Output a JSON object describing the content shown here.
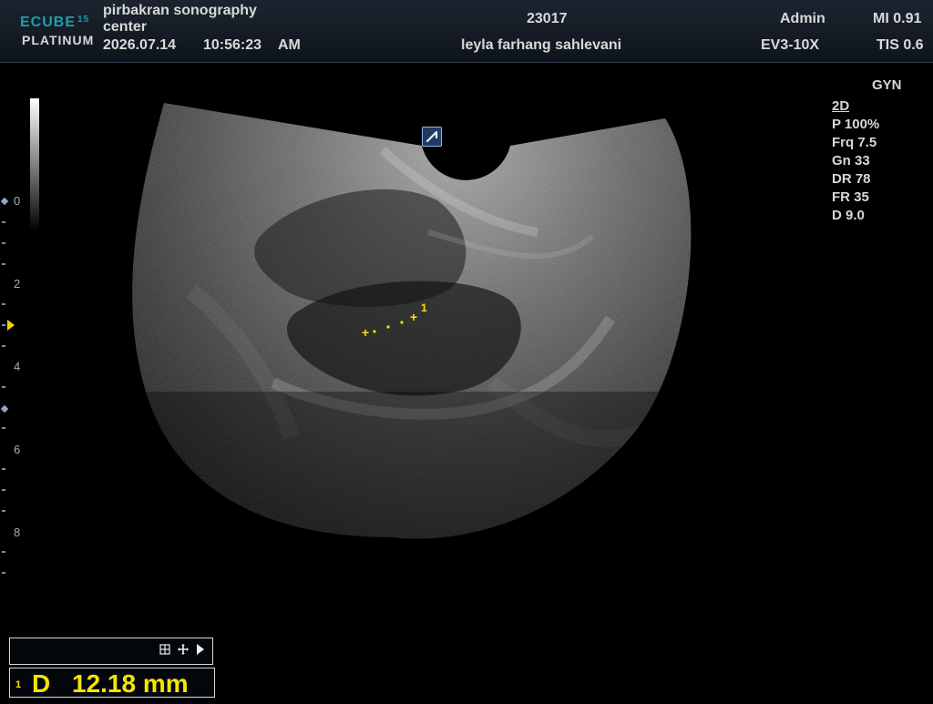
{
  "brand": {
    "line1": "ECUBE",
    "line1_number": "15",
    "line2": "PLATINUM"
  },
  "header": {
    "hospital": "pirbakran sonography\ncenter",
    "date": "2026.07.14",
    "time": "10:56:23",
    "ampm": "AM",
    "patient_id": "23017",
    "patient_name": "leyla farhang sahlevani",
    "user": "Admin",
    "probe": "EV3-10X",
    "mi": "MI 0.91",
    "tis": "TIS 0.6"
  },
  "params": {
    "preset": "GYN",
    "mode": "2D",
    "rows": [
      "P 100%",
      "Frq 7.5",
      "Gn 33",
      "DR 78",
      "FR 35",
      "D 9.0"
    ]
  },
  "depth_scale": {
    "labels": [
      "0",
      "2",
      "4",
      "6",
      "8"
    ]
  },
  "caliper": {
    "index": "1"
  },
  "measurement": {
    "index": "1",
    "label": "D",
    "value": "12.18 mm"
  },
  "icons": {
    "probe_orientation": "probe-orientation-icon",
    "grid": "grid-icon",
    "move": "move-icon",
    "expand": "arrow-right-icon"
  },
  "colors": {
    "caliper": "#f7e500",
    "brand_accent": "#1b9fb1"
  }
}
